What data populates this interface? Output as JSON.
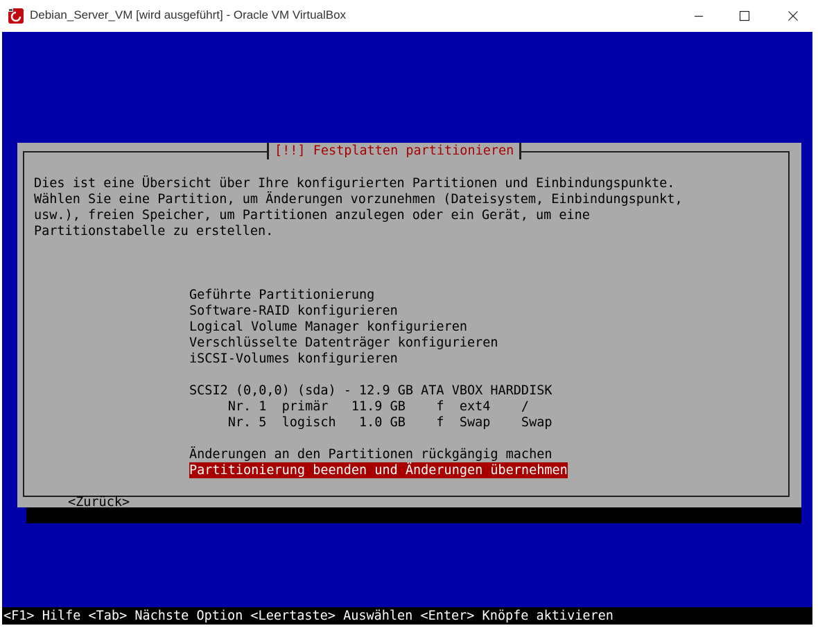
{
  "window": {
    "title": "Debian_Server_VM [wird ausgeführt] - Oracle VM VirtualBox"
  },
  "dialog": {
    "title": "[!!] Festplatten partitionieren",
    "description": [
      "Dies ist eine Übersicht über Ihre konfigurierten Partitionen und Einbindungspunkte.",
      "Wählen Sie eine Partition, um Änderungen vorzunehmen (Dateisystem, Einbindungspunkt,",
      "usw.), freien Speicher, um Partitionen anzulegen oder ein Gerät, um eine",
      "Partitionstabelle zu erstellen."
    ],
    "menu_items": [
      "Geführte Partitionierung",
      "Software-RAID konfigurieren",
      "Logical Volume Manager konfigurieren",
      "Verschlüsselte Datenträger konfigurieren",
      "iSCSI-Volumes konfigurieren"
    ],
    "disk": "SCSI2 (0,0,0) (sda) - 12.9 GB ATA VBOX HARDDISK",
    "partitions": [
      "     Nr. 1  primär   11.9 GB    f  ext4    /",
      "     Nr. 5  logisch   1.0 GB    f  Swap    Swap"
    ],
    "undo_option": "Änderungen an den Partitionen rückgängig machen",
    "finish_option": "Partitionierung beenden und Änderungen übernehmen",
    "back_button": "<Zurück>"
  },
  "status_bar": "<F1> Hilfe <Tab> Nächste Option <Leertaste> Auswählen <Enter> Knöpfe aktivieren",
  "colors": {
    "screen_bg": "#0000a8",
    "dialog_bg": "#aaaaaa",
    "title_text": "#a80000",
    "selection_bg": "#a80000",
    "selection_text": "#ffffff"
  },
  "icons": {
    "app": "virtualbox-icon",
    "minimize": "minimize-icon",
    "maximize": "maximize-icon",
    "close": "close-icon"
  }
}
